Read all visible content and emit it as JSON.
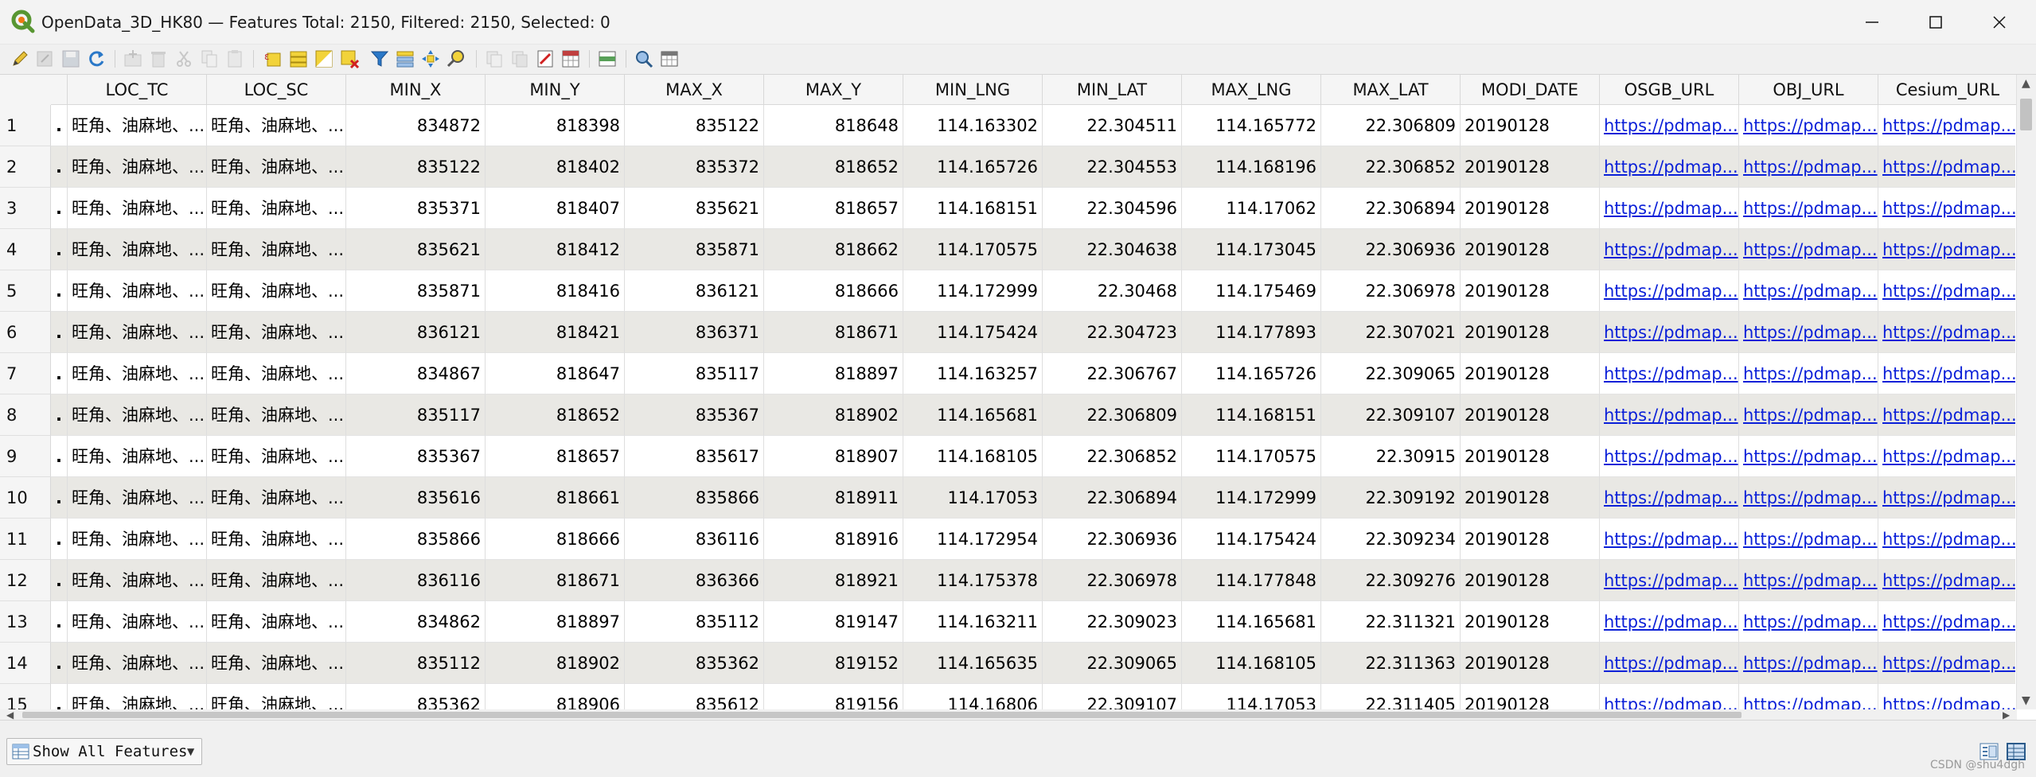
{
  "window": {
    "title": "OpenData_3D_HK80 — Features Total: 2150, Filtered: 2150, Selected: 0",
    "controls": [
      "minimize",
      "maximize",
      "close"
    ]
  },
  "toolbar": {
    "icons": [
      "pencil-edit-icon",
      "multi-edit-icon",
      "save-edits-icon",
      "reload-icon",
      "add-feature-icon",
      "delete-feature-icon",
      "cut-icon",
      "copy-icon",
      "paste-icon",
      "expression-select-icon",
      "select-all-icon",
      "invert-selection-icon",
      "deselect-all-icon",
      "filter-icon",
      "move-selection-top-icon",
      "pan-to-selection-icon",
      "zoom-to-selection-icon",
      "copy-cell-icon",
      "paste-cell-icon",
      "delete-field-icon",
      "field-calculator-icon",
      "conditional-format-icon",
      "actions-icon",
      "dock-icon"
    ]
  },
  "table": {
    "columns": [
      "",
      "LOC_TC",
      "LOC_SC",
      "MIN_X",
      "MIN_Y",
      "MAX_X",
      "MAX_Y",
      "MIN_LNG",
      "MIN_LAT",
      "MAX_LNG",
      "MAX_LAT",
      "MODI_DATE",
      "OSGB_URL",
      "OBJ_URL",
      "Cesium_URL"
    ],
    "rows": [
      {
        "n": "1",
        "c0": ".",
        "loc_tc": "旺角、油麻地、...",
        "loc_sc": "旺角、油麻地、...",
        "min_x": "834872",
        "min_y": "818398",
        "max_x": "835122",
        "max_y": "818648",
        "min_lng": "114.163302",
        "min_lat": "22.304511",
        "max_lng": "114.165772",
        "max_lat": "22.306809",
        "date": "20190128",
        "osgb": "https://pdmap...",
        "obj": "https://pdmap...",
        "cesium": "https://pdmap..."
      },
      {
        "n": "2",
        "c0": ".",
        "loc_tc": "旺角、油麻地、...",
        "loc_sc": "旺角、油麻地、...",
        "min_x": "835122",
        "min_y": "818402",
        "max_x": "835372",
        "max_y": "818652",
        "min_lng": "114.165726",
        "min_lat": "22.304553",
        "max_lng": "114.168196",
        "max_lat": "22.306852",
        "date": "20190128",
        "osgb": "https://pdmap...",
        "obj": "https://pdmap...",
        "cesium": "https://pdmap..."
      },
      {
        "n": "3",
        "c0": ".",
        "loc_tc": "旺角、油麻地、...",
        "loc_sc": "旺角、油麻地、...",
        "min_x": "835371",
        "min_y": "818407",
        "max_x": "835621",
        "max_y": "818657",
        "min_lng": "114.168151",
        "min_lat": "22.304596",
        "max_lng": "114.17062",
        "max_lat": "22.306894",
        "date": "20190128",
        "osgb": "https://pdmap...",
        "obj": "https://pdmap...",
        "cesium": "https://pdmap..."
      },
      {
        "n": "4",
        "c0": ".",
        "loc_tc": "旺角、油麻地、...",
        "loc_sc": "旺角、油麻地、...",
        "min_x": "835621",
        "min_y": "818412",
        "max_x": "835871",
        "max_y": "818662",
        "min_lng": "114.170575",
        "min_lat": "22.304638",
        "max_lng": "114.173045",
        "max_lat": "22.306936",
        "date": "20190128",
        "osgb": "https://pdmap...",
        "obj": "https://pdmap...",
        "cesium": "https://pdmap..."
      },
      {
        "n": "5",
        "c0": ".",
        "loc_tc": "旺角、油麻地、...",
        "loc_sc": "旺角、油麻地、...",
        "min_x": "835871",
        "min_y": "818416",
        "max_x": "836121",
        "max_y": "818666",
        "min_lng": "114.172999",
        "min_lat": "22.30468",
        "max_lng": "114.175469",
        "max_lat": "22.306978",
        "date": "20190128",
        "osgb": "https://pdmap...",
        "obj": "https://pdmap...",
        "cesium": "https://pdmap..."
      },
      {
        "n": "6",
        "c0": ".",
        "loc_tc": "旺角、油麻地、...",
        "loc_sc": "旺角、油麻地、...",
        "min_x": "836121",
        "min_y": "818421",
        "max_x": "836371",
        "max_y": "818671",
        "min_lng": "114.175424",
        "min_lat": "22.304723",
        "max_lng": "114.177893",
        "max_lat": "22.307021",
        "date": "20190128",
        "osgb": "https://pdmap...",
        "obj": "https://pdmap...",
        "cesium": "https://pdmap..."
      },
      {
        "n": "7",
        "c0": ".",
        "loc_tc": "旺角、油麻地、...",
        "loc_sc": "旺角、油麻地、...",
        "min_x": "834867",
        "min_y": "818647",
        "max_x": "835117",
        "max_y": "818897",
        "min_lng": "114.163257",
        "min_lat": "22.306767",
        "max_lng": "114.165726",
        "max_lat": "22.309065",
        "date": "20190128",
        "osgb": "https://pdmap...",
        "obj": "https://pdmap...",
        "cesium": "https://pdmap..."
      },
      {
        "n": "8",
        "c0": ".",
        "loc_tc": "旺角、油麻地、...",
        "loc_sc": "旺角、油麻地、...",
        "min_x": "835117",
        "min_y": "818652",
        "max_x": "835367",
        "max_y": "818902",
        "min_lng": "114.165681",
        "min_lat": "22.306809",
        "max_lng": "114.168151",
        "max_lat": "22.309107",
        "date": "20190128",
        "osgb": "https://pdmap...",
        "obj": "https://pdmap...",
        "cesium": "https://pdmap..."
      },
      {
        "n": "9",
        "c0": ".",
        "loc_tc": "旺角、油麻地、...",
        "loc_sc": "旺角、油麻地、...",
        "min_x": "835367",
        "min_y": "818657",
        "max_x": "835617",
        "max_y": "818907",
        "min_lng": "114.168105",
        "min_lat": "22.306852",
        "max_lng": "114.170575",
        "max_lat": "22.30915",
        "date": "20190128",
        "osgb": "https://pdmap...",
        "obj": "https://pdmap...",
        "cesium": "https://pdmap..."
      },
      {
        "n": "10",
        "c0": ".",
        "loc_tc": "旺角、油麻地、...",
        "loc_sc": "旺角、油麻地、...",
        "min_x": "835616",
        "min_y": "818661",
        "max_x": "835866",
        "max_y": "818911",
        "min_lng": "114.17053",
        "min_lat": "22.306894",
        "max_lng": "114.172999",
        "max_lat": "22.309192",
        "date": "20190128",
        "osgb": "https://pdmap...",
        "obj": "https://pdmap...",
        "cesium": "https://pdmap..."
      },
      {
        "n": "11",
        "c0": ".",
        "loc_tc": "旺角、油麻地、...",
        "loc_sc": "旺角、油麻地、...",
        "min_x": "835866",
        "min_y": "818666",
        "max_x": "836116",
        "max_y": "818916",
        "min_lng": "114.172954",
        "min_lat": "22.306936",
        "max_lng": "114.175424",
        "max_lat": "22.309234",
        "date": "20190128",
        "osgb": "https://pdmap...",
        "obj": "https://pdmap...",
        "cesium": "https://pdmap..."
      },
      {
        "n": "12",
        "c0": ".",
        "loc_tc": "旺角、油麻地、...",
        "loc_sc": "旺角、油麻地、...",
        "min_x": "836116",
        "min_y": "818671",
        "max_x": "836366",
        "max_y": "818921",
        "min_lng": "114.175378",
        "min_lat": "22.306978",
        "max_lng": "114.177848",
        "max_lat": "22.309276",
        "date": "20190128",
        "osgb": "https://pdmap...",
        "obj": "https://pdmap...",
        "cesium": "https://pdmap..."
      },
      {
        "n": "13",
        "c0": ".",
        "loc_tc": "旺角、油麻地、...",
        "loc_sc": "旺角、油麻地、...",
        "min_x": "834862",
        "min_y": "818897",
        "max_x": "835112",
        "max_y": "819147",
        "min_lng": "114.163211",
        "min_lat": "22.309023",
        "max_lng": "114.165681",
        "max_lat": "22.311321",
        "date": "20190128",
        "osgb": "https://pdmap...",
        "obj": "https://pdmap...",
        "cesium": "https://pdmap..."
      },
      {
        "n": "14",
        "c0": ".",
        "loc_tc": "旺角、油麻地、...",
        "loc_sc": "旺角、油麻地、...",
        "min_x": "835112",
        "min_y": "818902",
        "max_x": "835362",
        "max_y": "819152",
        "min_lng": "114.165635",
        "min_lat": "22.309065",
        "max_lng": "114.168105",
        "max_lat": "22.311363",
        "date": "20190128",
        "osgb": "https://pdmap...",
        "obj": "https://pdmap...",
        "cesium": "https://pdmap..."
      },
      {
        "n": "15",
        "c0": ".",
        "loc_tc": "旺角、油麻地、...",
        "loc_sc": "旺角、油麻地、...",
        "min_x": "835362",
        "min_y": "818906",
        "max_x": "835612",
        "max_y": "819156",
        "min_lng": "114.16806",
        "min_lat": "22.309107",
        "max_lng": "114.17053",
        "max_lat": "22.311405",
        "date": "20190128",
        "osgb": "https://pdmap...",
        "obj": "https://pdmap...",
        "cesium": "https://pdmap..."
      }
    ]
  },
  "statusbar": {
    "filter_label": "Show All Features",
    "watermark": "CSDN @shu4dgh"
  },
  "colors": {
    "link": "#0b20d8",
    "row_alt": "#e9e8e4",
    "logo_green": "#589632",
    "logo_yellow": "#ee7913"
  }
}
